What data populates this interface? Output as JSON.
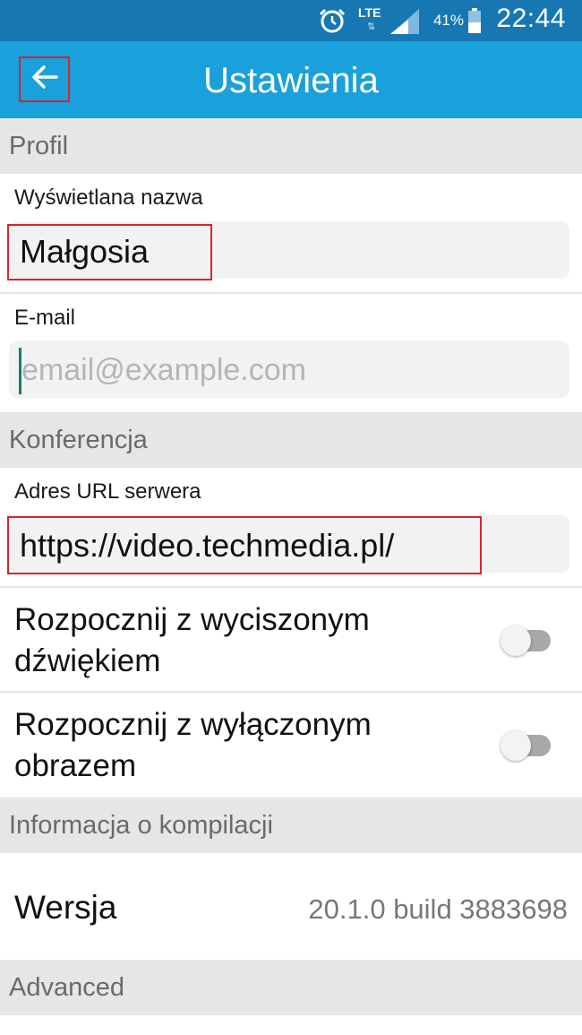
{
  "status_bar": {
    "network": "LTE",
    "battery_percent": "41%",
    "time": "22:44",
    "icons": [
      "alarm-icon",
      "signal-icon",
      "battery-icon"
    ]
  },
  "toolbar": {
    "title": "Ustawienia",
    "back_icon": "arrow-left-icon"
  },
  "sections": {
    "profile": {
      "header": "Profil",
      "display_name_label": "Wyświetlana nazwa",
      "display_name_value": "Małgosia",
      "email_label": "E-mail",
      "email_placeholder": "email@example.com"
    },
    "conference": {
      "header": "Konferencja",
      "server_url_label": "Adres URL serwera",
      "server_url_value": "https://video.techmedia.pl/",
      "start_muted_label": "Rozpocznij z wyciszonym dźwiękiem",
      "start_muted_on": false,
      "start_video_off_label": "Rozpocznij z wyłączonym obrazem",
      "start_video_off_on": false
    },
    "build_info": {
      "header": "Informacja o kompilacji",
      "version_label": "Wersja",
      "version_value": "20.1.0 build 3883698"
    },
    "advanced": {
      "header": "Advanced"
    }
  },
  "colors": {
    "status_bar": "#1677b3",
    "toolbar": "#1aa0db",
    "section_header_bg": "#e6e6e6",
    "highlight": "#d9232d"
  }
}
